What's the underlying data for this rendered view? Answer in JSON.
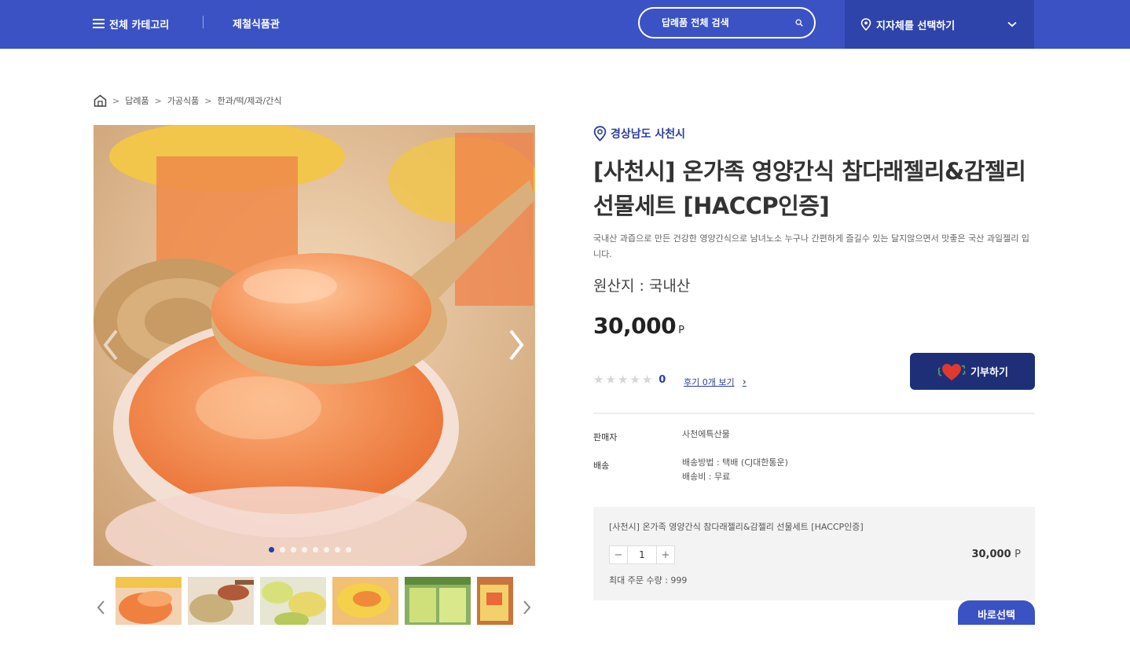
{
  "header": {
    "category_label": "전체 카테고리",
    "nav_link": "제철식품관",
    "search_placeholder": "답례품 전체 검색",
    "region_select_label": "지자체를 선택하기"
  },
  "breadcrumb": [
    "답례품",
    "가공식품",
    "한과/떡/제과/간식"
  ],
  "product": {
    "region": "경상남도 사천시",
    "title": "[사천시] 온가족 영양간식 참다래젤리&감젤리 선물세트 [HACCP인증]",
    "description": "국내산 과즙으로 만든 건강한 영양간식으로 남녀노소 누구나 간편하게 즐길수 있는 달지않으면서 맛좋은 국산 과일젤리 입니다.",
    "origin": "원산지 : 국내산",
    "price": "30,000",
    "price_unit": "P",
    "rating_count": "0",
    "reviews_link": "후기 0개 보기",
    "donate_button": "기부하기",
    "seller_label": "판매자",
    "seller_value": "사천에특산물",
    "delivery_label": "배송",
    "delivery_method": "배송방법 : 택배 (CJ대한통운)",
    "delivery_fee": "배송비 : 무료"
  },
  "gallery": {
    "slide_count": 8,
    "active_slide": 1,
    "thumbnail_count": 6
  },
  "order": {
    "item_name": "[사천시] 온가족 영양간식 참다래젤리&감젤리 선물세트 [HACCP인증]",
    "quantity": "1",
    "minus": "−",
    "plus": "+",
    "item_price": "30,000",
    "item_price_unit": "P",
    "max_qty": "최대 주문 수량 : 999",
    "buy_button": "바로선택"
  },
  "colors": {
    "header_bg": "#3b52c4",
    "region_bg": "#2f44aa",
    "accent_navy": "#1e2f78",
    "link_blue": "#2b3f9e"
  }
}
